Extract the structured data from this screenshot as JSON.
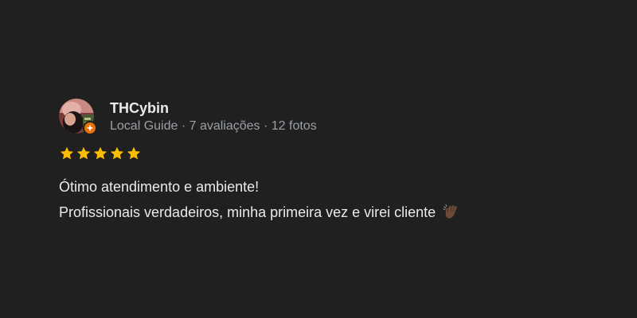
{
  "review": {
    "reviewer": {
      "name": "THCybin",
      "meta": "Local Guide · 7 avaliações · 12 fotos",
      "avatar_icon": "user-avatar",
      "badge_icon": "local-guide-star-icon"
    },
    "rating": 5,
    "text_lines": [
      "Ótimo atendimento e ambiente!",
      "Profissionais verdadeiros, minha primeira vez e virei cliente"
    ],
    "trailing_icon": "clapping-hands-icon"
  },
  "colors": {
    "background": "#202020",
    "star": "#fbbc04",
    "badge": "#e8710a",
    "text_primary": "#e8eaed",
    "text_secondary": "#9aa0a6"
  }
}
